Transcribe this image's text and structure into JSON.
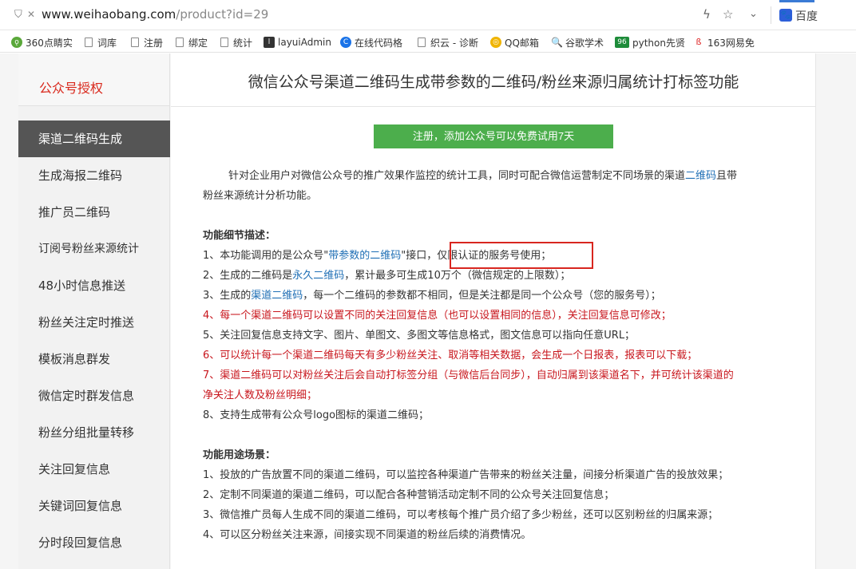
{
  "browser": {
    "url_host": "www.weihaobang.com",
    "url_path": "/product?id=29",
    "search_engine": "百度",
    "bookmarks": [
      "360点睛实",
      "词库",
      "注册",
      "绑定",
      "统计",
      "layuiAdmin",
      "在线代码格",
      "织云 - 诊断",
      "QQ邮箱",
      "谷歌学术",
      "python先贤",
      "163网易免"
    ]
  },
  "sidebar": {
    "title": "公众号授权",
    "items": [
      "渠道二维码生成",
      "生成海报二维码",
      "推广员二维码",
      "订阅号粉丝来源统计",
      "48小时信息推送",
      "粉丝关注定时推送",
      "模板消息群发",
      "微信定时群发信息",
      "粉丝分组批量转移",
      "关注回复信息",
      "关键词回复信息",
      "分时段回复信息"
    ]
  },
  "main": {
    "title": "微信公众号渠道二维码生成带参数的二维码/粉丝来源归属统计打标签功能",
    "cta": "注册，添加公众号可以免费试用7天",
    "intro": {
      "l1a": "针对企业用户对微信公众号的推广效果作监控的统计工具，同时可配合微信运营制定不同场景的渠道",
      "l1link": "二维码",
      "l1b": "且带",
      "l2": "粉丝来源统计分析功能。"
    },
    "features_title": "功能细节描述：",
    "f1": {
      "a": "1、本功能调用的是公众号\"",
      "link": "带参数的二维码",
      "b": "\"接口，",
      "c": "仅限认证的服务号使用；"
    },
    "f2": {
      "a": "2、生成的二维码是",
      "link": "永久二维码",
      "b": "，累计最多可生成10万个（微信规定的上限数）；"
    },
    "f3": {
      "a": "3、生成的",
      "link": "渠道二维码",
      "b": "，每一个二维码的参数都不相同，但是关注都是同一个公众号（您的服务号）；"
    },
    "f4": "4、每一个渠道二维码可以设置不同的关注回复信息（也可以设置相同的信息），关注回复信息可修改；",
    "f5": "5、关注回复信息支持文字、图片、单图文、多图文等信息格式，图文信息可以指向任意URL；",
    "f6": "6、可以统计每一个渠道二维码每天有多少粉丝关注、取消等相关数据，会生成一个日报表，报表可以下载；",
    "f7a": "7、渠道二维码可以对粉丝关注后会自动打标签分组（与微信后台同步），自动归属到该渠道名下，并可统计该渠道的",
    "f7b": "净关注人数及粉丝明细；",
    "f8": "8、支持生成带有公众号logo图标的渠道二维码；",
    "usage_title": "功能用途场景：",
    "u1": "1、投放的广告放置不同的渠道二维码，可以监控各种渠道广告带来的粉丝关注量，间接分析渠道广告的投放效果；",
    "u2": "2、定制不同渠道的渠道二维码，可以配合各种营销活动定制不同的公众号关注回复信息；",
    "u3": "3、微信推广员每人生成不同的渠道二维码，可以考核每个推广员介绍了多少粉丝，还可以区别粉丝的归属来源；",
    "u4": "4、可以区分粉丝关注来源，间接实现不同渠道的粉丝后续的消费情况。"
  },
  "colors": {
    "accent_red": "#d9281c",
    "link_blue": "#1f6fb5",
    "cta_green": "#4cae4c",
    "active_menu": "#555555"
  }
}
